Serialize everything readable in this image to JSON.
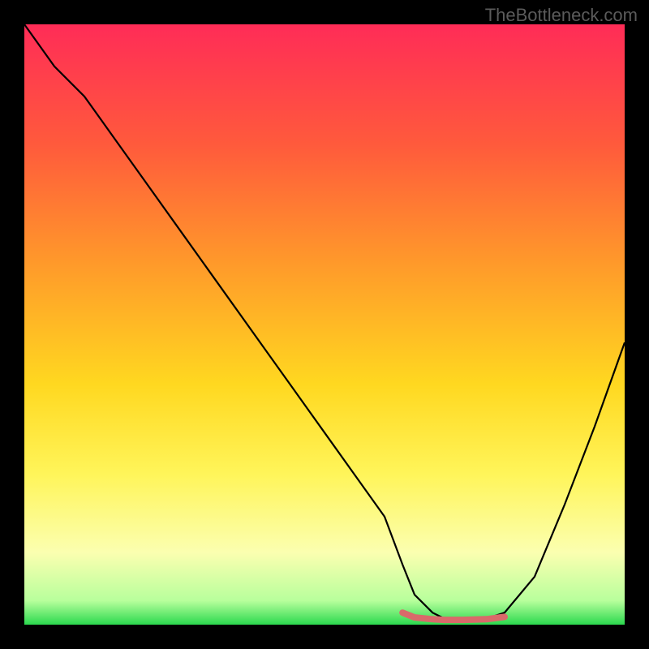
{
  "watermark": "TheBottleneck.com",
  "chart_data": {
    "type": "line",
    "title": "",
    "xlabel": "",
    "ylabel": "",
    "xlim": [
      0,
      100
    ],
    "ylim": [
      0,
      100
    ],
    "series": [
      {
        "name": "curve",
        "color": "#000000",
        "x": [
          0,
          5,
          10,
          15,
          20,
          25,
          30,
          35,
          40,
          45,
          50,
          55,
          60,
          63,
          65,
          68,
          70,
          73,
          77,
          80,
          85,
          90,
          95,
          100
        ],
        "y": [
          100,
          93,
          88,
          81,
          74,
          67,
          60,
          53,
          46,
          39,
          32,
          25,
          18,
          10,
          5,
          2,
          1,
          1,
          1,
          2,
          8,
          20,
          33,
          47
        ]
      },
      {
        "name": "highlight",
        "color": "#d96a6a",
        "x": [
          63,
          65,
          68,
          70,
          73,
          77,
          80
        ],
        "y": [
          2,
          1.2,
          0.9,
          0.8,
          0.8,
          0.9,
          1.3
        ]
      }
    ],
    "background_gradient": {
      "stops": [
        {
          "offset": 0,
          "color": "#ff2c57"
        },
        {
          "offset": 20,
          "color": "#ff5a3c"
        },
        {
          "offset": 40,
          "color": "#ff9a2a"
        },
        {
          "offset": 60,
          "color": "#ffd820"
        },
        {
          "offset": 75,
          "color": "#fff55a"
        },
        {
          "offset": 88,
          "color": "#fbffb0"
        },
        {
          "offset": 96,
          "color": "#b8ff9c"
        },
        {
          "offset": 100,
          "color": "#2bd94e"
        }
      ]
    }
  }
}
